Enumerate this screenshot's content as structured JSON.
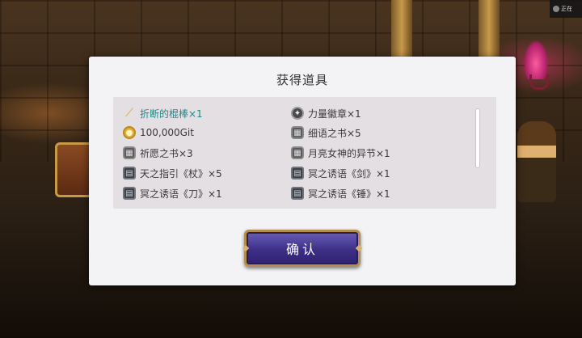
{
  "dialog": {
    "title": "获得道具",
    "confirm_label": "确认"
  },
  "items": [
    {
      "name": "折断的棍棒×1",
      "icon": "stick-icon",
      "highlight": true
    },
    {
      "name": "力量徽章×1",
      "icon": "badge-icon",
      "highlight": false
    },
    {
      "name": "100,000Git",
      "icon": "coin-icon",
      "highlight": false
    },
    {
      "name": "细语之书×5",
      "icon": "book-icon",
      "highlight": false
    },
    {
      "name": "祈愿之书×3",
      "icon": "book-icon",
      "highlight": false
    },
    {
      "name": "月亮女神的异节×1",
      "icon": "book-icon",
      "highlight": false
    },
    {
      "name": "天之指引《杖》×5",
      "icon": "scroll-icon",
      "highlight": false
    },
    {
      "name": "冥之诱语《剑》×1",
      "icon": "scroll-icon",
      "highlight": false
    },
    {
      "name": "冥之诱语《刀》×1",
      "icon": "scroll-icon",
      "highlight": false
    },
    {
      "name": "冥之诱语《锤》×1",
      "icon": "scroll-icon",
      "highlight": false
    }
  ],
  "status_chip": {
    "text": "正在"
  },
  "colors": {
    "highlight_text": "#1e8a8a",
    "button_purple": "#3d2f86",
    "button_border": "#b58e4e"
  }
}
